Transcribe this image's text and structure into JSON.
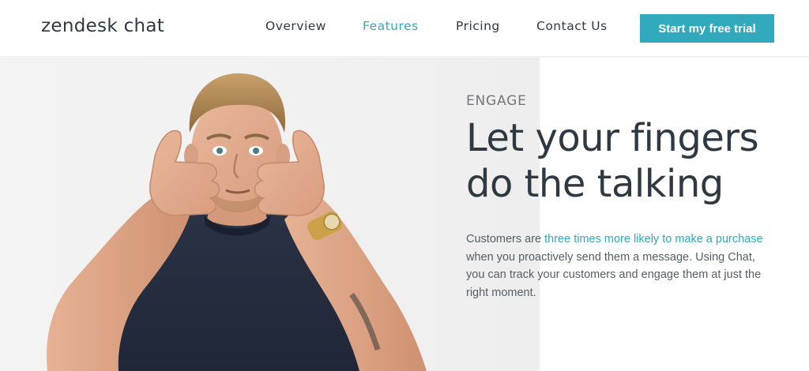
{
  "header": {
    "logo_text": "zendesk chat",
    "nav": [
      {
        "label": "Overview",
        "active": false
      },
      {
        "label": "Features",
        "active": true
      },
      {
        "label": "Pricing",
        "active": false
      },
      {
        "label": "Contact Us",
        "active": false
      }
    ],
    "cta_label": "Start my free trial"
  },
  "hero": {
    "eyebrow": "ENGAGE",
    "headline_line1": "Let your fingers",
    "headline_line2": "do the talking",
    "body": {
      "part1": "Customers are ",
      "link_text": "three times more likely to make a purchase",
      "part2": " when you proactively send them a message. Using Chat, you can track your customers and engage them at just the right moment."
    }
  },
  "colors": {
    "accent": "#30aabc",
    "heading": "#2f3941",
    "body": "#555f64",
    "eyebrow": "#73777a"
  },
  "icons": {
    "hero_image": "man-thumbs-up-photo"
  }
}
